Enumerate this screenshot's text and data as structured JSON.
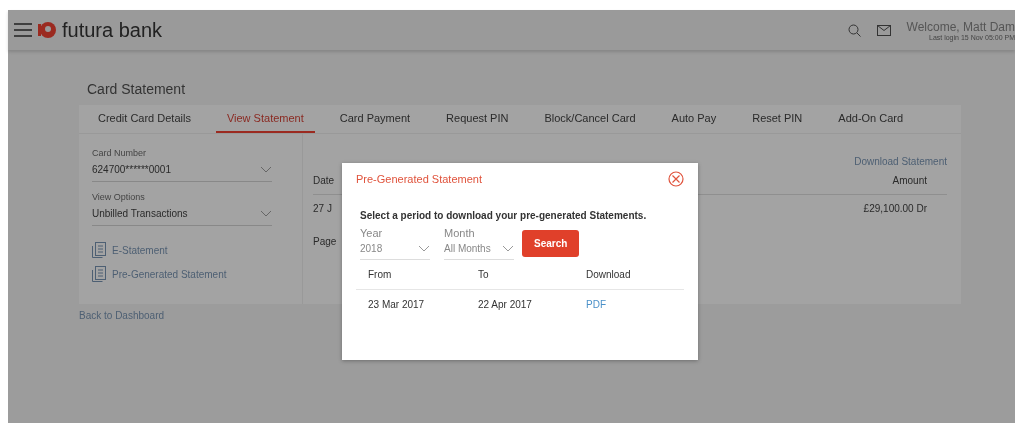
{
  "header": {
    "brand": "futura bank",
    "welcome": "Welcome, Matt Dam",
    "last_login": "Last login 15 Nov 05:00 PM"
  },
  "page_title": "Card Statement",
  "tabs": [
    {
      "label": "Credit Card Details",
      "selected": false
    },
    {
      "label": "View Statement",
      "selected": true
    },
    {
      "label": "Card Payment",
      "selected": false
    },
    {
      "label": "Request PIN",
      "selected": false
    },
    {
      "label": "Block/Cancel Card",
      "selected": false
    },
    {
      "label": "Auto Pay",
      "selected": false
    },
    {
      "label": "Reset PIN",
      "selected": false
    },
    {
      "label": "Add-On Card",
      "selected": false
    }
  ],
  "card_number": {
    "label": "Card Number",
    "value": "624700******0001"
  },
  "view_options": {
    "label": "View Options",
    "value": "Unbilled Transactions"
  },
  "statement_links": [
    {
      "label": "E-Statement"
    },
    {
      "label": "Pre-Generated Statement"
    }
  ],
  "statement": {
    "download_link": "Download Statement",
    "columns": [
      "Date",
      "Amount"
    ],
    "rows": [
      {
        "date": "27 J",
        "amount": "£29,100.00 Dr"
      }
    ],
    "pager": "Page"
  },
  "back_link": "Back to Dashboard",
  "modal": {
    "title": "Pre-Generated Statement",
    "instruction": "Select a period to download your pre-generated Statements.",
    "year": {
      "label": "Year",
      "value": "2018"
    },
    "month": {
      "label": "Month",
      "value": "All Months"
    },
    "search_button": "Search",
    "columns": [
      "From",
      "To",
      "Download"
    ],
    "rows": [
      {
        "from": "23 Mar 2017",
        "to": "22 Apr 2017",
        "download": "PDF"
      }
    ]
  }
}
